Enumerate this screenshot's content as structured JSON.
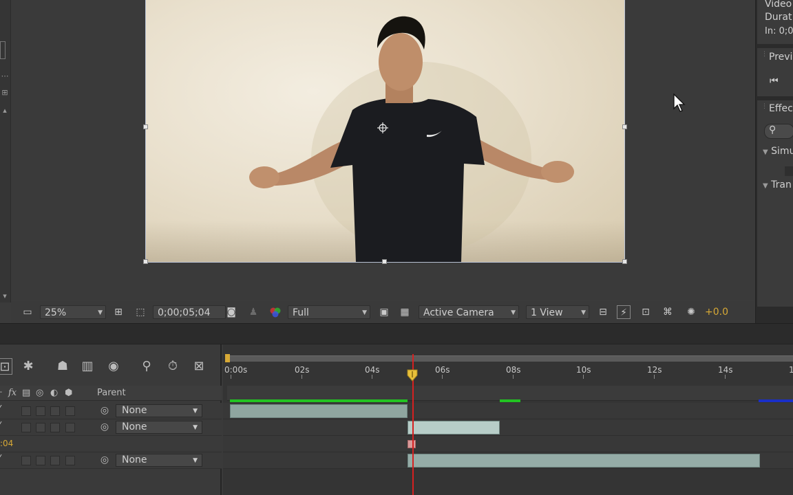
{
  "right_panels": {
    "info": {
      "line1": "Video",
      "line2": "Durat",
      "line3": "In: 0;0"
    },
    "preview": {
      "title": "Previ",
      "first_frame_icon": "first-frame-icon"
    },
    "effects": {
      "title": "Effec",
      "search_icon": "search-icon",
      "group1": "Simu",
      "group2": "Tran"
    }
  },
  "comp_toolbar": {
    "magnification": "25%",
    "timecode": "0;00;05;04",
    "resolution": "Full",
    "active_camera": "Active Camera",
    "views": "1 View",
    "exposure": "+0.0",
    "icons": [
      "comp-mini-flowchart-icon",
      "region-of-interest-icon",
      "transparency-grid-icon",
      "snapshot-icon",
      "show-snapshot-icon",
      "channel-rgb-icon",
      "fast-preview-icon",
      "flowchart-icon",
      "reset-exposure-icon"
    ]
  },
  "timeline": {
    "ruler_labels": [
      "0:00s",
      "02s",
      "04s",
      "06s",
      "08s",
      "10s",
      "12s",
      "14s",
      "1"
    ],
    "column_header": {
      "fx": "fx",
      "parent": "Parent"
    },
    "layers": [
      {
        "parent": "None",
        "timecode": ""
      },
      {
        "parent": "None",
        "timecode": ""
      },
      {
        "parent": "",
        "timecode": ":04"
      },
      {
        "parent": "None",
        "timecode": ""
      }
    ],
    "toolbar_icons": [
      "composition-mini-flowchart-icon",
      "draft-3d-icon",
      "shy-layers-icon",
      "frame-blending-icon",
      "motion-blur-icon",
      "graph-editor-icon",
      "brainstorm-icon",
      "live-update-icon"
    ]
  },
  "colors": {
    "accent_orange": "#d7a936",
    "cti_red": "#d62020",
    "cache_green": "#22c322",
    "layer_bar": "#8fa6a0"
  }
}
